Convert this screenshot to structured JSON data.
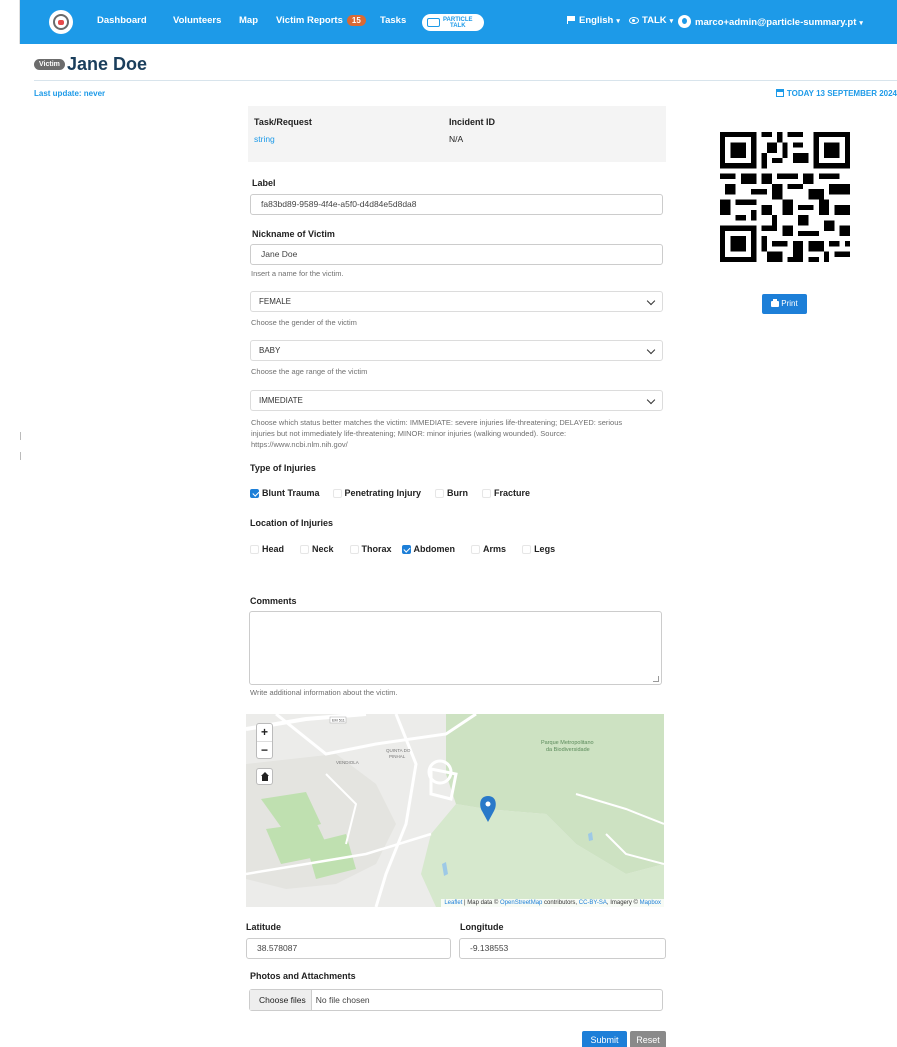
{
  "nav": {
    "links": [
      "Dashboard",
      "Volunteers",
      "Map",
      "Victim Reports",
      "Tasks"
    ],
    "victim_reports_count": "15",
    "talk_logo_line1": "PARTICLE",
    "talk_logo_line2": "TALK",
    "language": "English",
    "talk_menu": "TALK",
    "user_email": "marco+admin@particle-summary.pt"
  },
  "header": {
    "pill": "Victim",
    "title": "Jane Doe",
    "last_update": "Last update: never",
    "today": "TODAY 13 SEPTEMBER 2024"
  },
  "summary": {
    "task_label": "Task/Request",
    "task_value": "string",
    "incident_label": "Incident ID",
    "incident_value": "N/A"
  },
  "form": {
    "label_label": "Label",
    "label_value": "fa83bd89-9589-4f4e-a5f0-d4d84e5d8da8",
    "nickname_label": "Nickname of Victim",
    "nickname_value": "Jane Doe",
    "nickname_help": "Insert a name for the victim.",
    "gender_value": "FEMALE",
    "gender_help": "Choose the gender of the victim",
    "age_value": "BABY",
    "age_help": "Choose the age range of the victim",
    "status_value": "IMMEDIATE",
    "status_help_1": "Choose which status better matches the victim: IMMEDIATE: severe injuries life-threatening; DELAYED: serious",
    "status_help_2": "injuries but not immediately life-threatening; MINOR: minor injuries (walking wounded). Source:",
    "status_help_3": "https://www.ncbi.nlm.nih.gov/",
    "injury_type_label": "Type of Injuries",
    "injury_types": [
      {
        "label": "Blunt Trauma",
        "checked": true
      },
      {
        "label": "Penetrating Injury",
        "checked": false
      },
      {
        "label": "Burn",
        "checked": false
      },
      {
        "label": "Fracture",
        "checked": false
      }
    ],
    "location_label": "Location of Injuries",
    "locations": [
      {
        "label": "Head",
        "checked": false
      },
      {
        "label": "Neck",
        "checked": false
      },
      {
        "label": "Thorax",
        "checked": false
      },
      {
        "label": "Abdomen",
        "checked": true
      },
      {
        "label": "Arms",
        "checked": false
      },
      {
        "label": "Legs",
        "checked": false
      }
    ],
    "comments_label": "Comments",
    "comments_value": "",
    "comments_help": "Write additional information about the victim.",
    "latitude_label": "Latitude",
    "latitude_value": "38.578087",
    "longitude_label": "Longitude",
    "longitude_value": "-9.138553",
    "photos_label": "Photos and Attachments",
    "file_button": "Choose files",
    "file_status": "No file chosen",
    "submit": "Submit",
    "reset": "Reset"
  },
  "map": {
    "zoom_in": "+",
    "zoom_out": "−",
    "attribution_leaflet": "Leaflet",
    "attribution_text_1": " | Map data © ",
    "attribution_osm": "OpenStreetMap",
    "attribution_text_2": " contributors, ",
    "attribution_license": "CC-BY-SA",
    "attribution_text_3": ", Imagery © ",
    "attribution_mapbox": "Mapbox",
    "park_label_1": "Parque Metropolitano",
    "park_label_2": "da Biodiversidade",
    "place_label_1": "QUINTA DO",
    "place_label_2": "PINHAL",
    "place_label_3": "VENDIOLA",
    "road_label": "EM 511"
  },
  "sidebar": {
    "print_label": "Print"
  },
  "colors": {
    "navbar": "#1d9ae8",
    "primary": "#1d7fd8",
    "title": "#1a3e5c",
    "badge": "#d96a34"
  }
}
